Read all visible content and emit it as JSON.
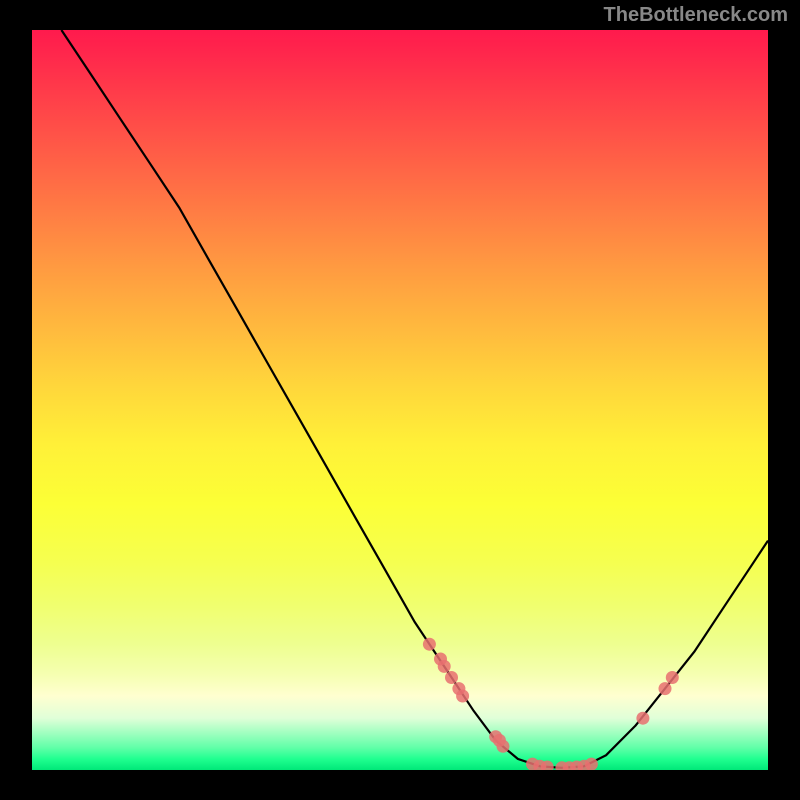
{
  "watermark": "TheBottleneck.com",
  "chart_data": {
    "type": "line",
    "title": "",
    "xlabel": "",
    "ylabel": "",
    "xlim": [
      0,
      100
    ],
    "ylim": [
      0,
      100
    ],
    "curve": [
      {
        "x": 4,
        "y": 100
      },
      {
        "x": 8,
        "y": 94
      },
      {
        "x": 12,
        "y": 88
      },
      {
        "x": 16,
        "y": 82
      },
      {
        "x": 20,
        "y": 76
      },
      {
        "x": 24,
        "y": 69
      },
      {
        "x": 28,
        "y": 62
      },
      {
        "x": 32,
        "y": 55
      },
      {
        "x": 36,
        "y": 48
      },
      {
        "x": 40,
        "y": 41
      },
      {
        "x": 44,
        "y": 34
      },
      {
        "x": 48,
        "y": 27
      },
      {
        "x": 52,
        "y": 20
      },
      {
        "x": 56,
        "y": 14
      },
      {
        "x": 60,
        "y": 8
      },
      {
        "x": 63,
        "y": 4
      },
      {
        "x": 66,
        "y": 1.5
      },
      {
        "x": 69,
        "y": 0.5
      },
      {
        "x": 72,
        "y": 0.3
      },
      {
        "x": 75,
        "y": 0.5
      },
      {
        "x": 78,
        "y": 2
      },
      {
        "x": 82,
        "y": 6
      },
      {
        "x": 86,
        "y": 11
      },
      {
        "x": 90,
        "y": 16
      },
      {
        "x": 94,
        "y": 22
      },
      {
        "x": 98,
        "y": 28
      },
      {
        "x": 100,
        "y": 31
      }
    ],
    "markers": [
      {
        "x": 54,
        "y": 17
      },
      {
        "x": 55.5,
        "y": 15
      },
      {
        "x": 56,
        "y": 14
      },
      {
        "x": 57,
        "y": 12.5
      },
      {
        "x": 58,
        "y": 11
      },
      {
        "x": 58.5,
        "y": 10
      },
      {
        "x": 63,
        "y": 4.5
      },
      {
        "x": 63.5,
        "y": 4
      },
      {
        "x": 64,
        "y": 3.2
      },
      {
        "x": 68,
        "y": 0.8
      },
      {
        "x": 69,
        "y": 0.5
      },
      {
        "x": 70,
        "y": 0.4
      },
      {
        "x": 72,
        "y": 0.3
      },
      {
        "x": 73,
        "y": 0.3
      },
      {
        "x": 74,
        "y": 0.4
      },
      {
        "x": 75,
        "y": 0.5
      },
      {
        "x": 76,
        "y": 0.8
      },
      {
        "x": 83,
        "y": 7
      },
      {
        "x": 86,
        "y": 11
      },
      {
        "x": 87,
        "y": 12.5
      }
    ],
    "gradient_stops": [
      {
        "pos": 0,
        "color": "#ff1a4d"
      },
      {
        "pos": 50,
        "color": "#ffd63b"
      },
      {
        "pos": 90,
        "color": "#ffffd0"
      },
      {
        "pos": 100,
        "color": "#00e878"
      }
    ]
  }
}
